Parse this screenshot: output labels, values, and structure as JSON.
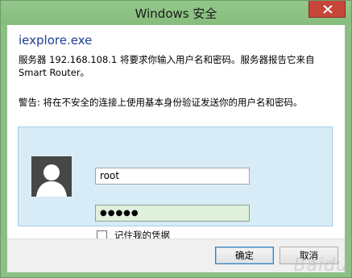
{
  "window": {
    "title": "Windows 安全"
  },
  "dialog": {
    "app_name": "iexplore.exe",
    "message": "服务器 192.168.108.1 将要求你输入用户名和密码。服务器报告它来自 Smart Router。",
    "warning": "警告: 将在不安全的连接上使用基本身份验证发送你的用户名和密码。",
    "username_value": "root",
    "password_mask": "●●●●●",
    "remember_label": "记住我的凭据",
    "remember_checked": false
  },
  "buttons": {
    "ok_label": "确定",
    "cancel_label": "取消"
  },
  "watermark": "Baidu",
  "colors": {
    "titlebar": "#8cc083",
    "close_button": "#c7463a",
    "heading_text": "#1c3f94",
    "credential_panel": "#d7ecf7",
    "password_field": "#dff0dc"
  }
}
